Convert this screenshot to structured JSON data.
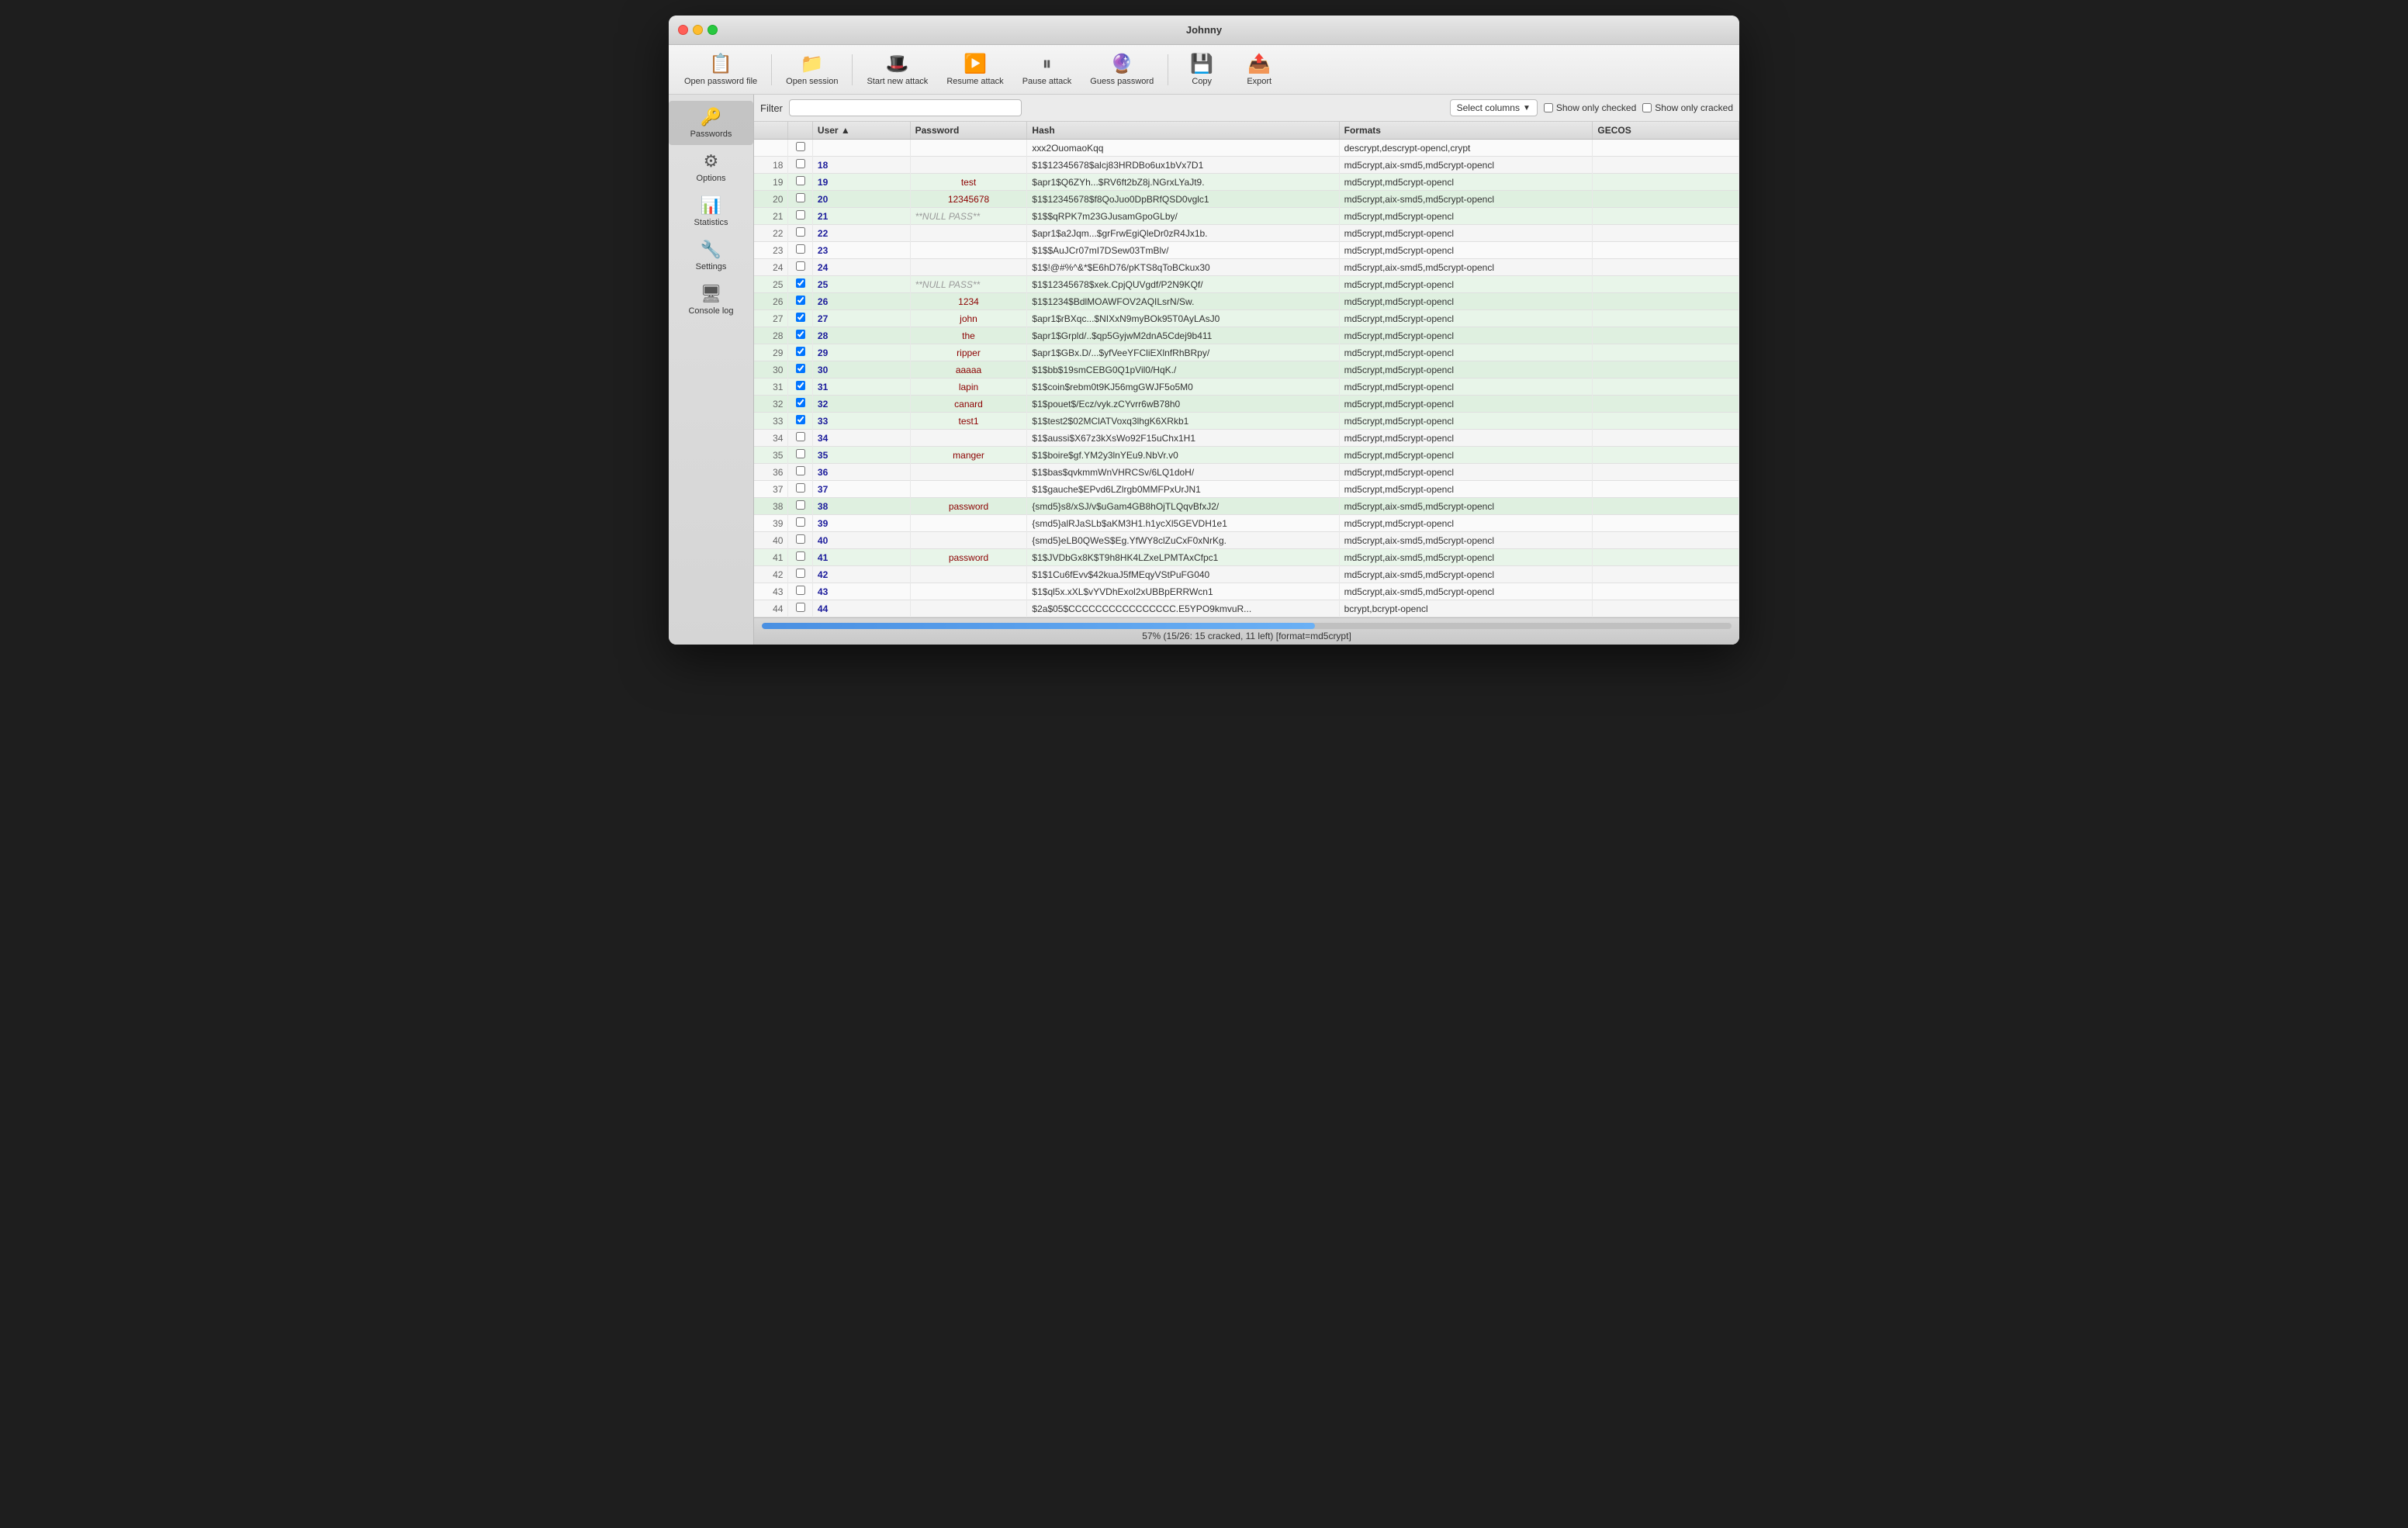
{
  "window": {
    "title": "Johnny"
  },
  "toolbar": {
    "buttons": [
      {
        "id": "open-password",
        "icon": "📋",
        "label": "Open password file"
      },
      {
        "id": "open-session",
        "icon": "📁",
        "label": "Open session"
      },
      {
        "id": "start-attack",
        "icon": "🎩",
        "label": "Start new attack"
      },
      {
        "id": "resume-attack",
        "icon": "▶",
        "label": "Resume attack"
      },
      {
        "id": "pause-attack",
        "icon": "⏸",
        "label": "Pause attack"
      },
      {
        "id": "guess-password",
        "icon": "🔮",
        "label": "Guess password"
      },
      {
        "id": "copy",
        "icon": "💾",
        "label": "Copy"
      },
      {
        "id": "export",
        "icon": "📤",
        "label": "Export"
      }
    ]
  },
  "sidebar": {
    "items": [
      {
        "id": "passwords",
        "icon": "🔑",
        "label": "Passwords"
      },
      {
        "id": "options",
        "icon": "⚙",
        "label": "Options"
      },
      {
        "id": "statistics",
        "icon": "📊",
        "label": "Statistics"
      },
      {
        "id": "settings",
        "icon": "🔧",
        "label": "Settings"
      },
      {
        "id": "console-log",
        "icon": "🖥",
        "label": "Console log"
      }
    ]
  },
  "filter": {
    "label": "Filter",
    "placeholder": "",
    "select_columns_label": "Select columns",
    "show_only_checked": "Show only checked",
    "show_only_cracked": "Show only cracked"
  },
  "table": {
    "columns": [
      "",
      "",
      "User",
      "Password",
      "Hash",
      "Formats",
      "GECOS"
    ],
    "rows": [
      {
        "num": "",
        "checked": false,
        "user": "",
        "password": "",
        "hash": "xxx2OuomaoKqq",
        "formats": "descrypt,descrypt-opencl,crypt",
        "gecos": "",
        "cracked": false
      },
      {
        "num": "18",
        "checked": false,
        "user": "18",
        "password": "",
        "hash": "$1$12345678$alcj83HRDBo6ux1bVx7D1",
        "formats": "md5crypt,aix-smd5,md5crypt-opencl",
        "gecos": "",
        "cracked": false
      },
      {
        "num": "19",
        "checked": false,
        "user": "19",
        "password": "test",
        "hash": "$apr1$Q6ZYh...$RV6ft2bZ8j.NGrxLYaJt9.",
        "formats": "md5crypt,md5crypt-opencl",
        "gecos": "",
        "cracked": true
      },
      {
        "num": "20",
        "checked": false,
        "user": "20",
        "password": "12345678",
        "hash": "$1$12345678$f8QoJuo0DpBRfQSD0vglc1",
        "formats": "md5crypt,aix-smd5,md5crypt-opencl",
        "gecos": "",
        "cracked": true
      },
      {
        "num": "21",
        "checked": false,
        "user": "21",
        "password": "**NULL PASS**",
        "hash": "$1$$qRPK7m23GJusamGpoGLby/",
        "formats": "md5crypt,md5crypt-opencl",
        "gecos": "",
        "cracked": true
      },
      {
        "num": "22",
        "checked": false,
        "user": "22",
        "password": "",
        "hash": "$apr1$a2Jqm...$grFrwEgiQleDr0zR4Jx1b.",
        "formats": "md5crypt,md5crypt-opencl",
        "gecos": "",
        "cracked": false
      },
      {
        "num": "23",
        "checked": false,
        "user": "23",
        "password": "",
        "hash": "$1$$AuJCr07mI7DSew03TmBlv/",
        "formats": "md5crypt,md5crypt-opencl",
        "gecos": "",
        "cracked": false
      },
      {
        "num": "24",
        "checked": false,
        "user": "24",
        "password": "",
        "hash": "$1$!@#%^&*$E6hD76/pKTS8qToBCkux30",
        "formats": "md5crypt,aix-smd5,md5crypt-opencl",
        "gecos": "",
        "cracked": false
      },
      {
        "num": "25",
        "checked": true,
        "user": "25",
        "password": "**NULL PASS**",
        "hash": "$1$12345678$xek.CpjQUVgdf/P2N9KQf/",
        "formats": "md5crypt,md5crypt-opencl",
        "gecos": "",
        "cracked": true
      },
      {
        "num": "26",
        "checked": true,
        "user": "26",
        "password": "1234",
        "hash": "$1$1234$BdlMOAWFOV2AQILsrN/Sw.",
        "formats": "md5crypt,md5crypt-opencl",
        "gecos": "",
        "cracked": true
      },
      {
        "num": "27",
        "checked": true,
        "user": "27",
        "password": "john",
        "hash": "$apr1$rBXqc...$NIXxN9myBOk95T0AyLAsJ0",
        "formats": "md5crypt,md5crypt-opencl",
        "gecos": "",
        "cracked": true
      },
      {
        "num": "28",
        "checked": true,
        "user": "28",
        "password": "the",
        "hash": "$apr1$Grpld/..$qp5GyjwM2dnA5Cdej9b411",
        "formats": "md5crypt,md5crypt-opencl",
        "gecos": "",
        "cracked": true
      },
      {
        "num": "29",
        "checked": true,
        "user": "29",
        "password": "ripper",
        "hash": "$apr1$GBx.D/...$yfVeeYFCliEXlnfRhBRpy/",
        "formats": "md5crypt,md5crypt-opencl",
        "gecos": "",
        "cracked": true
      },
      {
        "num": "30",
        "checked": true,
        "user": "30",
        "password": "aaaaa",
        "hash": "$1$bb$19smCEBG0Q1pVil0/HqK./",
        "formats": "md5crypt,md5crypt-opencl",
        "gecos": "",
        "cracked": true
      },
      {
        "num": "31",
        "checked": true,
        "user": "31",
        "password": "lapin",
        "hash": "$1$coin$rebm0t9KJ56mgGWJF5o5M0",
        "formats": "md5crypt,md5crypt-opencl",
        "gecos": "",
        "cracked": true
      },
      {
        "num": "32",
        "checked": true,
        "user": "32",
        "password": "canard",
        "hash": "$1$pouet$/Ecz/vyk.zCYvrr6wB78h0",
        "formats": "md5crypt,md5crypt-opencl",
        "gecos": "",
        "cracked": true
      },
      {
        "num": "33",
        "checked": true,
        "user": "33",
        "password": "test1",
        "hash": "$1$test2$02MClATVoxq3lhgK6XRkb1",
        "formats": "md5crypt,md5crypt-opencl",
        "gecos": "",
        "cracked": true
      },
      {
        "num": "34",
        "checked": false,
        "user": "34",
        "password": "",
        "hash": "$1$aussi$X67z3kXsWo92F15uChx1H1",
        "formats": "md5crypt,md5crypt-opencl",
        "gecos": "",
        "cracked": false
      },
      {
        "num": "35",
        "checked": false,
        "user": "35",
        "password": "manger",
        "hash": "$1$boire$gf.YM2y3lnYEu9.NbVr.v0",
        "formats": "md5crypt,md5crypt-opencl",
        "gecos": "",
        "cracked": true
      },
      {
        "num": "36",
        "checked": false,
        "user": "36",
        "password": "",
        "hash": "$1$bas$qvkmmWnVHRCSv/6LQ1doH/",
        "formats": "md5crypt,md5crypt-opencl",
        "gecos": "",
        "cracked": false
      },
      {
        "num": "37",
        "checked": false,
        "user": "37",
        "password": "",
        "hash": "$1$gauche$EPvd6LZlrgb0MMFPxUrJN1",
        "formats": "md5crypt,md5crypt-opencl",
        "gecos": "",
        "cracked": false
      },
      {
        "num": "38",
        "checked": false,
        "user": "38",
        "password": "password",
        "hash": "{smd5}s8/xSJ/v$uGam4GB8hOjTLQqvBfxJ2/",
        "formats": "md5crypt,aix-smd5,md5crypt-opencl",
        "gecos": "",
        "cracked": true
      },
      {
        "num": "39",
        "checked": false,
        "user": "39",
        "password": "",
        "hash": "{smd5}alRJaSLb$aKM3H1.h1ycXl5GEVDH1e1",
        "formats": "md5crypt,md5crypt-opencl",
        "gecos": "",
        "cracked": false
      },
      {
        "num": "40",
        "checked": false,
        "user": "40",
        "password": "",
        "hash": "{smd5}eLB0QWeS$Eg.YfWY8clZuCxF0xNrKg.",
        "formats": "md5crypt,aix-smd5,md5crypt-opencl",
        "gecos": "",
        "cracked": false
      },
      {
        "num": "41",
        "checked": false,
        "user": "41",
        "password": "password",
        "hash": "$1$JVDbGx8K$T9h8HK4LZxeLPMTAxCfpc1",
        "formats": "md5crypt,aix-smd5,md5crypt-opencl",
        "gecos": "",
        "cracked": true
      },
      {
        "num": "42",
        "checked": false,
        "user": "42",
        "password": "",
        "hash": "$1$1Cu6fEvv$42kuaJ5fMEqyVStPuFG040",
        "formats": "md5crypt,aix-smd5,md5crypt-opencl",
        "gecos": "",
        "cracked": false
      },
      {
        "num": "43",
        "checked": false,
        "user": "43",
        "password": "",
        "hash": "$1$ql5x.xXL$vYVDhExol2xUBBpERRWcn1",
        "formats": "md5crypt,aix-smd5,md5crypt-opencl",
        "gecos": "",
        "cracked": false
      },
      {
        "num": "44",
        "checked": false,
        "user": "44",
        "password": "",
        "hash": "$2a$05$CCCCCCCCCCCCCCCC.E5YPO9kmvuR...",
        "formats": "bcrypt,bcrypt-opencl",
        "gecos": "",
        "cracked": false
      }
    ]
  },
  "status": {
    "progress_text": "57% (15/26: 15 cracked, 11 left) [format=md5crypt]",
    "progress_pct": 57
  }
}
